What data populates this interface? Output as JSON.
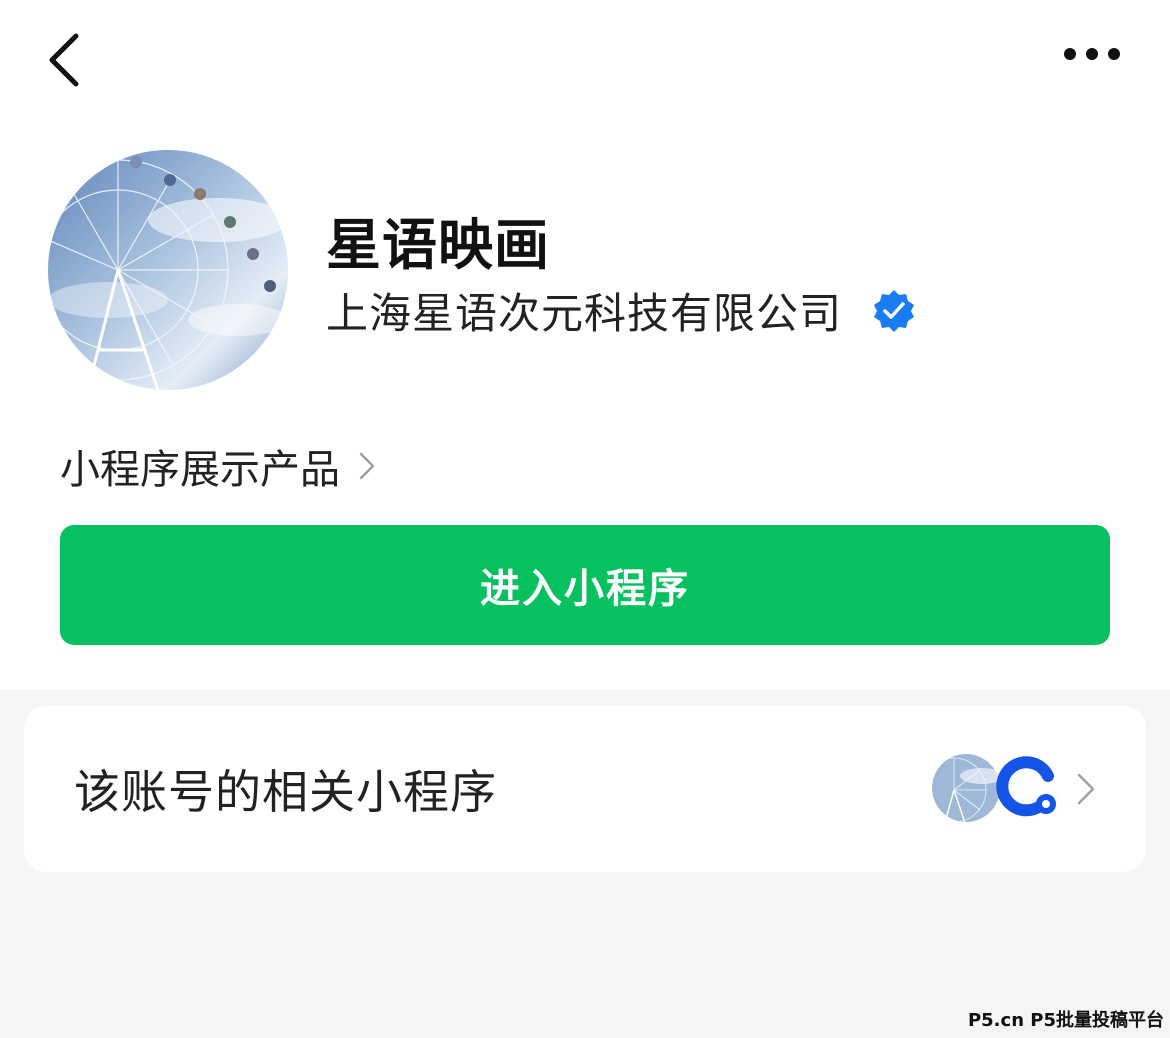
{
  "header": {
    "back_icon": "chevron-left-icon",
    "more_icon": "more-dots-icon"
  },
  "profile": {
    "avatar": "ferris-wheel-avatar",
    "name": "星语映画",
    "company": "上海星语次元科技有限公司",
    "verified_icon": "verified-badge-icon",
    "verified_color": "#1a7cf2"
  },
  "products": {
    "label": "小程序展示产品",
    "chevron_icon": "chevron-right-icon"
  },
  "enter_button": {
    "label": "进入小程序",
    "color": "#07c160"
  },
  "related": {
    "label": "该账号的相关小程序",
    "logo_icon": "mini-program-logo-icon",
    "logo_color": "#1454e6",
    "chevron_icon": "chevron-right-icon"
  },
  "watermark": "P5.cn P5批量投稿平台"
}
